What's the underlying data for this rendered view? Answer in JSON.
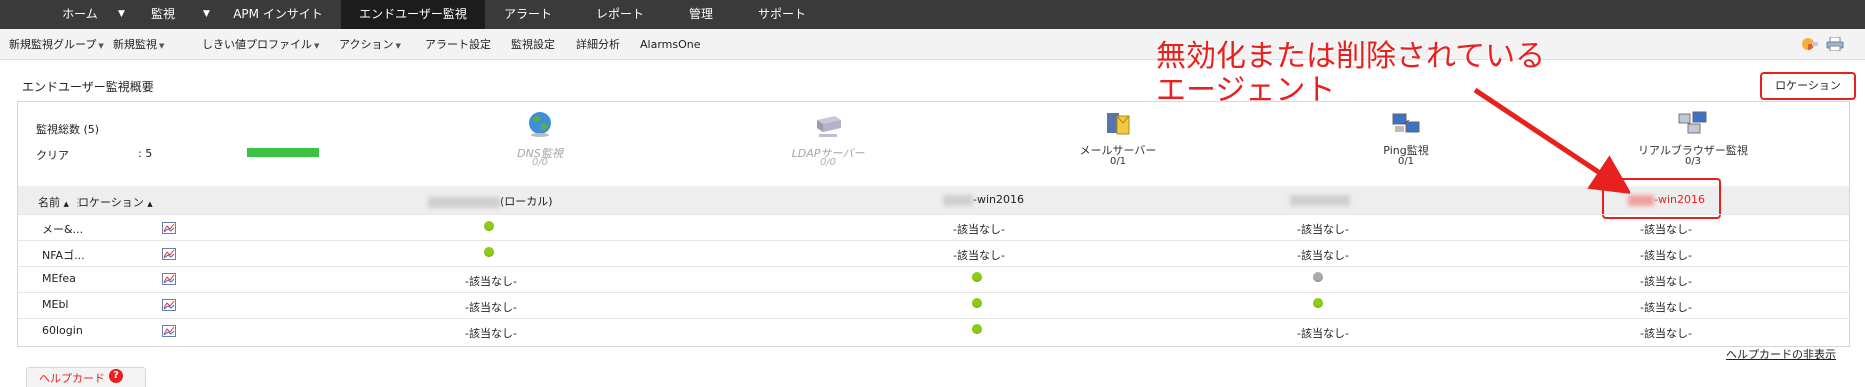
{
  "topnav": {
    "items": [
      "ホーム",
      "監視",
      "APM インサイト",
      "エンドユーザー監視",
      "アラート",
      "レポート",
      "管理",
      "サポート"
    ],
    "active": "エンドユーザー監視"
  },
  "subnav": {
    "items": [
      "新規監視グループ",
      "新規監視",
      "しきい値プロファイル",
      "アクション",
      "アラート設定",
      "監視設定",
      "詳細分析",
      "AlarmsOne"
    ]
  },
  "page": {
    "title": "エンドユーザー監視概要",
    "location_button": "ロケーション"
  },
  "summary": {
    "total_label": "監視総数 (5)",
    "clear_label": "クリア",
    "clear_value": ": 5",
    "clear_ratio": 1.0,
    "monitors": [
      {
        "name": "DNS監視",
        "count": "0/0",
        "dim": true,
        "icon": "globe-icon"
      },
      {
        "name": "LDAPサーバー",
        "count": "0/0",
        "dim": true,
        "icon": "ldap-server-icon"
      },
      {
        "name": "メールサーバー",
        "count": "0/1",
        "dim": false,
        "icon": "mail-server-icon"
      },
      {
        "name": "Ping監視",
        "count": "0/1",
        "dim": false,
        "icon": "ping-icon"
      },
      {
        "name": "リアルブラウザー監視",
        "count": "0/3",
        "dim": false,
        "icon": "real-browser-icon"
      }
    ]
  },
  "table": {
    "col_name": "名前",
    "col_location": "ロケーション",
    "locations": [
      "(ローカル)",
      "-win2016",
      "",
      "-win2016"
    ],
    "rows": [
      {
        "name": "メー&...",
        "cells": [
          "up",
          "-該当なし-",
          "-該当なし-",
          "-該当なし-"
        ]
      },
      {
        "name": "NFAゴ...",
        "cells": [
          "up",
          "-該当なし-",
          "-該当なし-",
          "-該当なし-"
        ]
      },
      {
        "name": "MEfea",
        "cells": [
          "-該当なし-",
          "up",
          "gray",
          "-該当なし-"
        ]
      },
      {
        "name": "MEbl",
        "cells": [
          "-該当なし-",
          "up",
          "up",
          "-該当なし-"
        ]
      },
      {
        "name": "60login",
        "cells": [
          "-該当なし-",
          "up",
          "-該当なし-",
          "-該当なし-"
        ]
      }
    ]
  },
  "annotation": {
    "line1": "無効化または削除されている",
    "line2": "エージェント"
  },
  "footer": {
    "hide_help": "ヘルプカードの非表示",
    "help_card": "ヘルプカード",
    "help_q": "?"
  },
  "colors": {
    "accent_red": "#e8201e",
    "status_green": "#8ccd14",
    "status_gray": "#aaaaaa",
    "nav_bg": "#3a3a3a"
  }
}
